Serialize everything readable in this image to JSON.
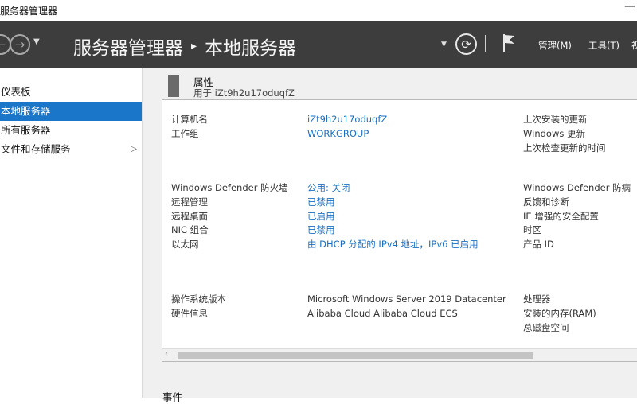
{
  "window": {
    "title": "服务器管理器",
    "minimize": "—"
  },
  "header": {
    "back_icon": "←",
    "forward_icon": "→",
    "nav_dropdown": "▼",
    "breadcrumb_root": "服务器管理器",
    "breadcrumb_sep": "▸",
    "breadcrumb_current": "本地服务器",
    "header_dropdown": "▼",
    "refresh_icon": "⟳",
    "menu": {
      "manage": "管理(M)",
      "tools": "工具(T)",
      "view": "视"
    }
  },
  "sidebar": {
    "items": [
      {
        "label": "仪表板",
        "active": false
      },
      {
        "label": "本地服务器",
        "active": true
      },
      {
        "label": "所有服务器",
        "active": false
      },
      {
        "label": "文件和存储服务",
        "active": false,
        "expand": "▷"
      }
    ]
  },
  "properties": {
    "title": "属性",
    "subtitle": "用于 iZt9h2u17oduqfZ",
    "left": [
      {
        "label": "计算机名",
        "value": "iZt9h2u17oduqfZ"
      },
      {
        "label": "工作组",
        "value": "WORKGROUP"
      },
      {
        "label": "Windows Defender 防火墙",
        "value": "公用: 关闭"
      },
      {
        "label": "远程管理",
        "value": "已禁用"
      },
      {
        "label": "远程桌面",
        "value": "已启用"
      },
      {
        "label": "NIC 组合",
        "value": "已禁用"
      },
      {
        "label": "以太网",
        "value": "由 DHCP 分配的 IPv4 地址，IPv6 已启用"
      },
      {
        "label": "操作系统版本",
        "value": "Microsoft Windows Server 2019 Datacenter"
      },
      {
        "label": "硬件信息",
        "value": "Alibaba Cloud Alibaba Cloud ECS"
      }
    ],
    "right": [
      "上次安装的更新",
      "Windows 更新",
      "上次检查更新的时间",
      "Windows Defender 防病",
      "反馈和诊断",
      "IE 增强的安全配置",
      "时区",
      "产品 ID",
      "处理器",
      "安装的内存(RAM)",
      "总磁盘空间"
    ],
    "scroll_left": "‹"
  },
  "events": {
    "title": "事件"
  }
}
